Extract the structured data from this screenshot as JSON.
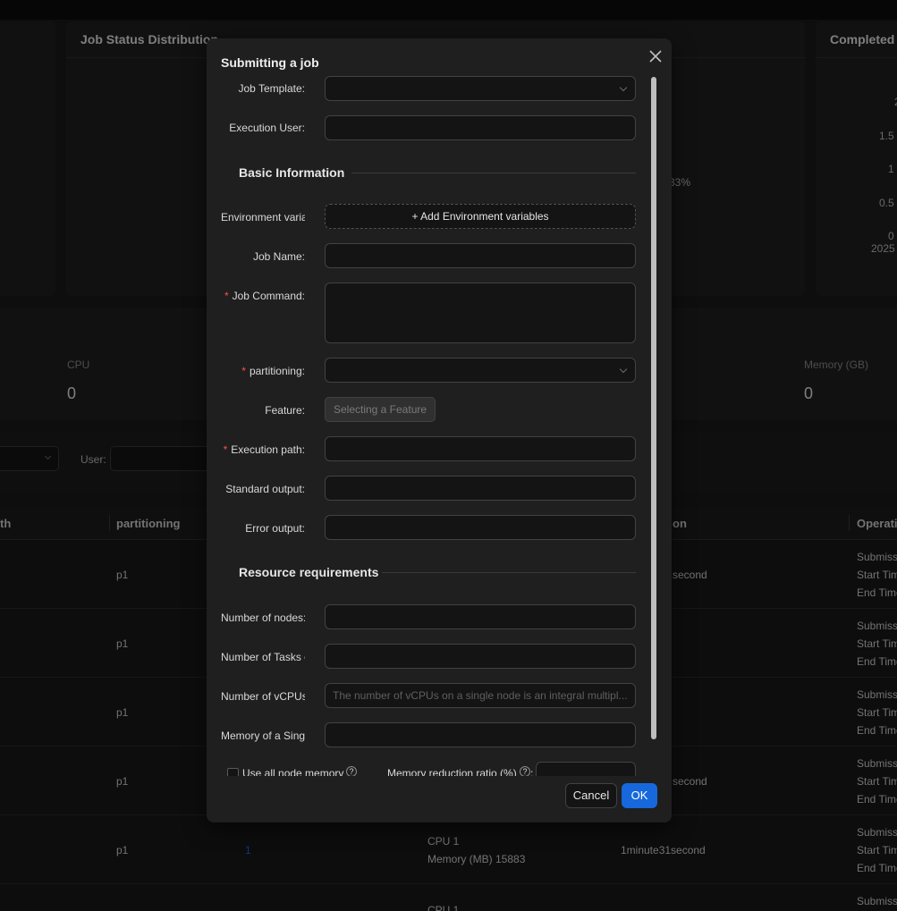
{
  "background": {
    "cards": {
      "job_status_title": "Job Status Distribution",
      "completed_title": "Completed _",
      "percent_label": "33%",
      "y_ticks": [
        "2",
        "1.5",
        "1",
        "0.5",
        "0"
      ],
      "x_tick": "2025"
    },
    "stats": {
      "cpu_label": "CPU",
      "cpu_value": "0",
      "memory_label": "Memory (GB)",
      "memory_value": "0"
    },
    "filters": {
      "user_label": "User:"
    },
    "table": {
      "columns": [
        "th",
        "partitioning",
        "on",
        "Operatio"
      ],
      "rows": [
        {
          "partition": "p1",
          "duration": "second",
          "nodes": "",
          "cpu": "",
          "memory": ""
        },
        {
          "partition": "p1",
          "duration": "",
          "nodes": "",
          "cpu": "",
          "memory": ""
        },
        {
          "partition": "p1",
          "duration": "",
          "nodes": "",
          "cpu": "",
          "memory": ""
        },
        {
          "partition": "p1",
          "duration": "second",
          "nodes": "",
          "cpu": "",
          "memory": ""
        },
        {
          "partition": "p1",
          "duration": "1minute31second",
          "nodes": "1",
          "cpu": "CPU    1",
          "memory": "Memory (MB)    15883"
        }
      ],
      "last_row_cpu": "CPU    1",
      "operation_lines": [
        "Submiss",
        "Start Tim",
        "End Time"
      ]
    }
  },
  "modal": {
    "title": "Submitting a job",
    "fields": {
      "job_template": {
        "label": "Job Template:",
        "value": ""
      },
      "execution_user": {
        "label": "Execution User:",
        "value": ""
      },
      "env_vars": {
        "label": "Environment variat",
        "button": "+ Add Environment variables"
      },
      "job_name": {
        "label": "Job Name:",
        "value": ""
      },
      "job_command": {
        "label": "Job Command:",
        "value": ""
      },
      "partitioning": {
        "label": "partitioning:",
        "value": ""
      },
      "feature": {
        "label": "Feature:",
        "button": "Selecting a Feature"
      },
      "execution_path": {
        "label": "Execution path:",
        "value": ""
      },
      "standard_output": {
        "label": "Standard output:",
        "value": ""
      },
      "error_output": {
        "label": "Error output:",
        "value": ""
      },
      "num_nodes": {
        "label": "Number of nodes:",
        "value": ""
      },
      "num_tasks": {
        "label": "Number of Tasks o",
        "value": ""
      },
      "num_vcpus": {
        "label": "Number of vCPUs",
        "placeholder": "The number of vCPUs on a single node is an integral multipl..."
      },
      "memory_single": {
        "label": "Memory of a Singl",
        "value": ""
      },
      "use_all_memory": {
        "label": "Use all node memory",
        "checked": false
      },
      "memory_reduction": {
        "label": "Memory reduction ratio (%)",
        "value": ""
      }
    },
    "sections": {
      "basic": "Basic Information",
      "resources": "Resource requirements"
    },
    "buttons": {
      "cancel": "Cancel",
      "ok": "OK"
    }
  },
  "colors": {
    "primary": "#1668dc",
    "required": "#ff4d4f"
  }
}
